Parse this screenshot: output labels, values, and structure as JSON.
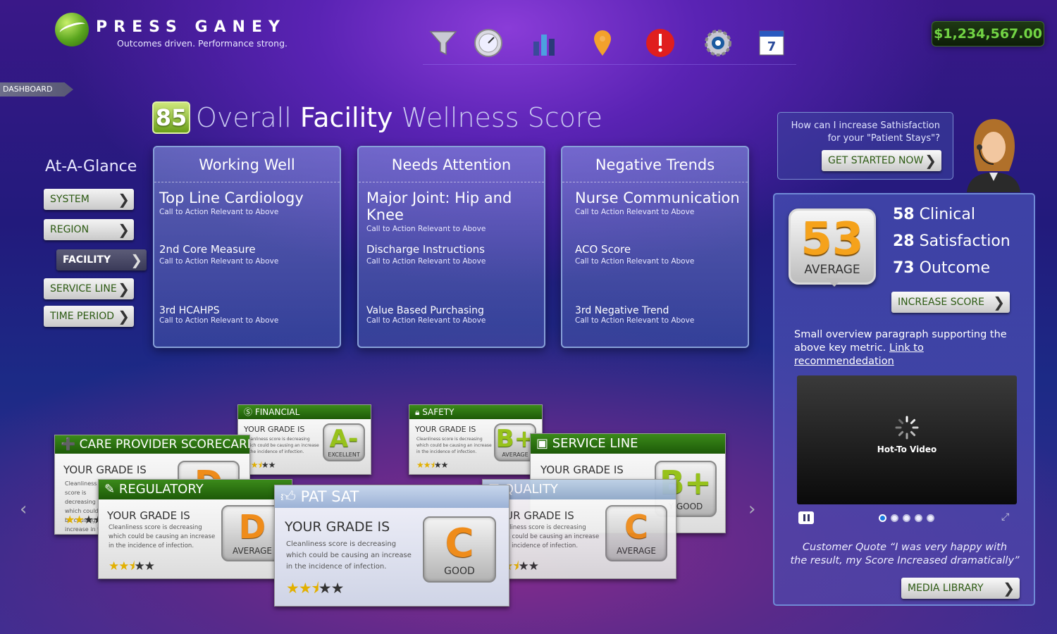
{
  "brand": {
    "name": "PRESS GANEY",
    "tagline": "Outcomes driven. Performance strong."
  },
  "toolbar": {
    "icons": [
      "filter-icon",
      "gauge-icon",
      "bar-chart-icon",
      "location-pin-icon",
      "alert-icon",
      "settings-icon",
      "calendar-icon"
    ],
    "calendar_day": "7"
  },
  "balance": "$1,234,567.00",
  "breadcrumb": "DASHBOARD",
  "headline": {
    "score": "85",
    "part1": "Overall",
    "part2": "Facility",
    "part3": "Wellness Score"
  },
  "glance": {
    "title": "At-A-Glance",
    "items": [
      {
        "label": "SYSTEM"
      },
      {
        "label": "REGION"
      },
      {
        "label": "FACILITY"
      },
      {
        "label": "SERVICE LINE"
      },
      {
        "label": "TIME PERIOD"
      }
    ]
  },
  "panels": [
    {
      "title": "Working Well",
      "items": [
        {
          "title": "Top Line Cardiology",
          "sub": "Call to Action Relevant to Above"
        },
        {
          "title": "2nd Core Measure",
          "sub": "Call to Action Relevant to Above"
        },
        {
          "title": "3rd HCAHPS",
          "sub": "Call to Action Relevant to Above"
        }
      ]
    },
    {
      "title": "Needs Attention",
      "items": [
        {
          "title": "Major Joint: Hip and Knee",
          "sub": "Call to Action Relevant to Above"
        },
        {
          "title": "Discharge Instructions",
          "sub": "Call to Action Relevant to Above"
        },
        {
          "title": "Value Based Purchasing",
          "sub": "Call to Action Relevant to Above"
        }
      ]
    },
    {
      "title": "Negative Trends",
      "items": [
        {
          "title": "Nurse Communication",
          "sub": "Call to Action Relevant to Above"
        },
        {
          "title": "ACO Score",
          "sub": "Call to Action Relevant to Above"
        },
        {
          "title": "3rd Negative Trend",
          "sub": "Call to Action Relevant to Above"
        }
      ]
    }
  ],
  "help": {
    "line1": "How can I increase Sathisfaction",
    "line2": "for your \"Patient Stays\"?",
    "button": "GET STARTED NOW"
  },
  "scorecard": {
    "score": "53",
    "score_label": "AVERAGE",
    "metrics": [
      {
        "value": "58",
        "label": "Clinical"
      },
      {
        "value": "28",
        "label": "Satisfaction"
      },
      {
        "value": "73",
        "label": "Outcome"
      }
    ],
    "increase_button": "INCREASE SCORE",
    "overview": "Small overview paragraph supporting the above key metric.",
    "overview_link": "Link to recommendedation",
    "video_caption": "Hot-To Video",
    "video_dots": 5,
    "quote_line1": "Customer Quote “I was very happy with",
    "quote_line2": "the result, my Score Increased dramatically”",
    "media_button": "MEDIA LIBRARY"
  },
  "cards": {
    "your_grade": "YOUR GRADE IS",
    "desc": "Cleanliness score is decreasing which could be causing an increase in the incidence of infection.",
    "financial": {
      "title": "FINANCIAL",
      "grade": "A-",
      "word": "EXCELLENT",
      "stars": 2.5
    },
    "safety": {
      "title": "SAFETY",
      "grade": "B+",
      "word": "AVERAGE",
      "stars": 2.5
    },
    "care": {
      "title": "CARE PROVIDER SCORECARD",
      "grade": "D",
      "word": "",
      "stars": 2
    },
    "service": {
      "title": "SERVICE LINE",
      "grade": "B+",
      "word": "Y GOOD"
    },
    "regulatory": {
      "title": "REGULATORY",
      "grade": "D",
      "word": "AVERAGE",
      "stars": 2.5
    },
    "quality": {
      "title": "QUALITY",
      "grade": "C",
      "word": "AVERAGE",
      "stars": 2.5
    },
    "patsat": {
      "title": "PAT SAT",
      "grade": "C",
      "word": "GOOD",
      "stars": 2.5
    }
  }
}
